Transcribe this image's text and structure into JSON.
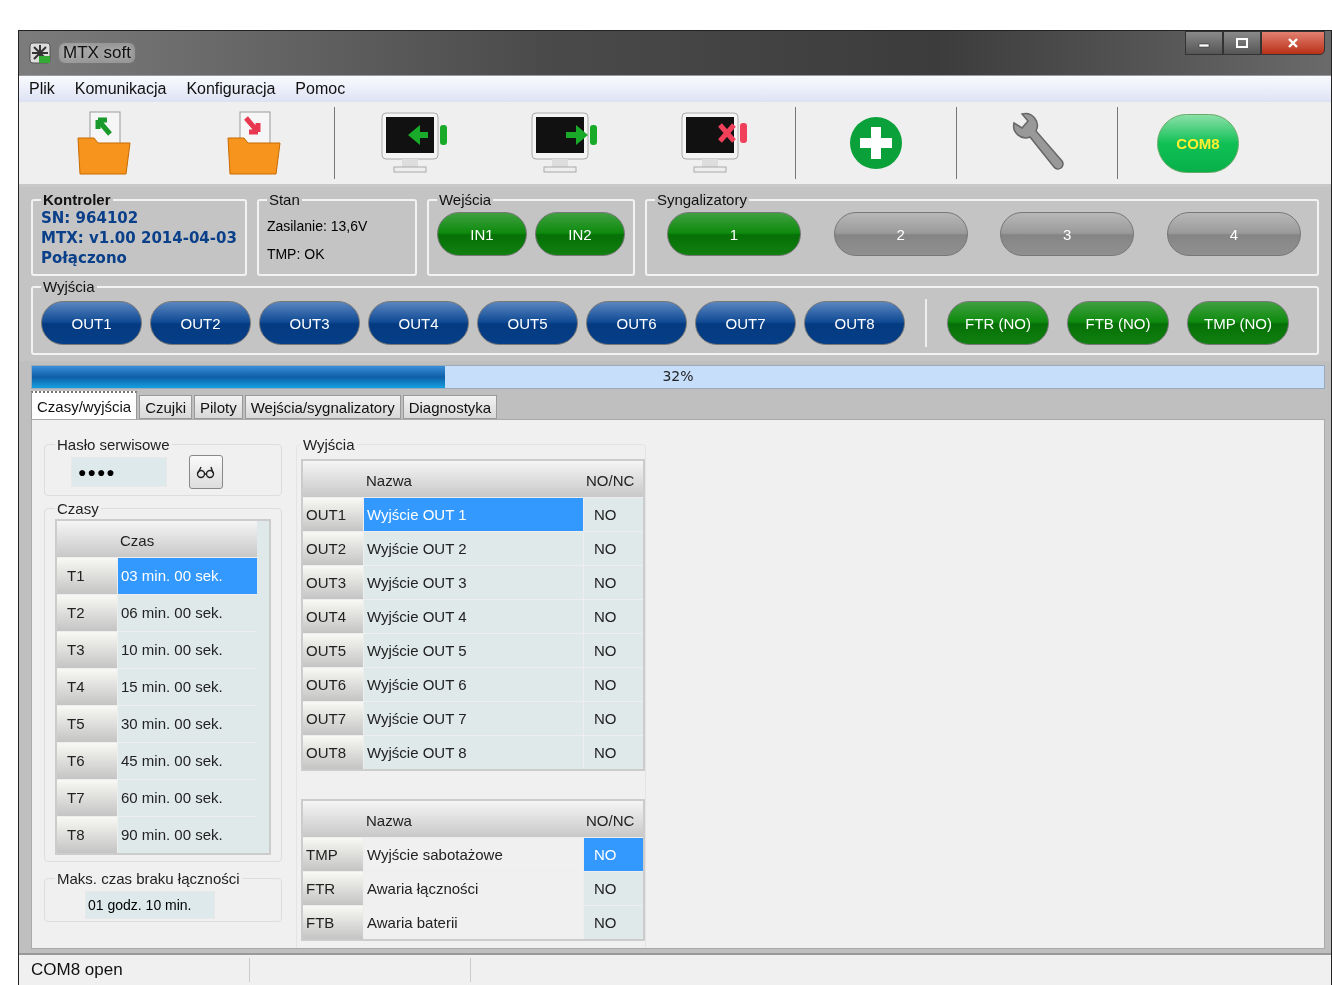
{
  "window": {
    "title": "MTX soft"
  },
  "menu": [
    "Plik",
    "Komunikacja",
    "Konfiguracja",
    "Pomoc"
  ],
  "toolbar": {
    "port_button": "COM8"
  },
  "controller": {
    "title": "Kontroler",
    "lines": [
      "SN:  964102",
      "MTX: v1.00 2014-04-03",
      "Połączono"
    ]
  },
  "status": {
    "title": "Stan",
    "lines": [
      "Zasilanie: 13,6V",
      "TMP: OK"
    ]
  },
  "inputs": {
    "title": "Wejścia",
    "buttons": [
      {
        "label": "IN1",
        "on": true
      },
      {
        "label": "IN2",
        "on": true
      }
    ]
  },
  "signalers": {
    "title": "Syngalizatory",
    "buttons": [
      {
        "label": "1",
        "on": true
      },
      {
        "label": "2",
        "on": false
      },
      {
        "label": "3",
        "on": false
      },
      {
        "label": "4",
        "on": false
      }
    ]
  },
  "outputs": {
    "title": "Wyjścia",
    "buttons": [
      {
        "label": "OUT1",
        "kind": "output"
      },
      {
        "label": "OUT2",
        "kind": "output"
      },
      {
        "label": "OUT3",
        "kind": "output"
      },
      {
        "label": "OUT4",
        "kind": "output"
      },
      {
        "label": "OUT5",
        "kind": "output"
      },
      {
        "label": "OUT6",
        "kind": "output"
      },
      {
        "label": "OUT7",
        "kind": "output"
      },
      {
        "label": "OUT8",
        "kind": "output"
      }
    ],
    "fault_buttons": [
      {
        "label": "FTR (NO)",
        "kind": "fault"
      },
      {
        "label": "FTB (NO)",
        "kind": "fault"
      },
      {
        "label": "TMP (NO)",
        "kind": "fault"
      }
    ]
  },
  "progress": {
    "level": 0.32,
    "reading": "32%"
  },
  "tabs": [
    {
      "label": "Czasy/wyjścia",
      "selected": true
    },
    {
      "label": "Czujki",
      "selected": false
    },
    {
      "label": "Piloty",
      "selected": false
    },
    {
      "label": "Wejścia/sygnalizatory",
      "selected": false
    },
    {
      "label": "Diagnostyka",
      "selected": false
    }
  ],
  "password": {
    "title": "Hasło serwisowe",
    "value": "●●●●"
  },
  "times": {
    "title": "Czasy",
    "column": "Czas",
    "rows": [
      {
        "label": "T1",
        "value": "03 min. 00 sek.",
        "selected": true
      },
      {
        "label": "T2",
        "value": "06 min. 00 sek.",
        "selected": false
      },
      {
        "label": "T3",
        "value": "10 min. 00 sek.",
        "selected": false
      },
      {
        "label": "T4",
        "value": "15 min. 00 sek.",
        "selected": false
      },
      {
        "label": "T5",
        "value": "30 min. 00 sek.",
        "selected": false
      },
      {
        "label": "T6",
        "value": "45 min. 00 sek.",
        "selected": false
      },
      {
        "label": "T7",
        "value": "60 min. 00 sek.",
        "selected": false
      },
      {
        "label": "T8",
        "value": "90 min. 00 sek.",
        "selected": false
      }
    ]
  },
  "max_offline": {
    "title": "Maks. czas braku łączności",
    "value": "01 godz. 10 min."
  },
  "outputs_panel": {
    "title": "Wyjścia",
    "tables": [
      {
        "columns": [
          "Nazwa",
          "NO/NC"
        ],
        "rows": [
          {
            "id": "OUT1",
            "name": "Wyjście OUT 1",
            "mode": "NO",
            "name_selected": true,
            "mode_selected": false
          },
          {
            "id": "OUT2",
            "name": "Wyjście OUT 2",
            "mode": "NO",
            "name_selected": false,
            "mode_selected": false
          },
          {
            "id": "OUT3",
            "name": "Wyjście OUT 3",
            "mode": "NO",
            "name_selected": false,
            "mode_selected": false
          },
          {
            "id": "OUT4",
            "name": "Wyjście OUT 4",
            "mode": "NO",
            "name_selected": false,
            "mode_selected": false
          },
          {
            "id": "OUT5",
            "name": "Wyjście OUT 5",
            "mode": "NO",
            "name_selected": false,
            "mode_selected": false
          },
          {
            "id": "OUT6",
            "name": "Wyjście OUT 6",
            "mode": "NO",
            "name_selected": false,
            "mode_selected": false
          },
          {
            "id": "OUT7",
            "name": "Wyjście OUT 7",
            "mode": "NO",
            "name_selected": false,
            "mode_selected": false
          },
          {
            "id": "OUT8",
            "name": "Wyjście OUT 8",
            "mode": "NO",
            "name_selected": false,
            "mode_selected": false
          }
        ]
      },
      {
        "columns": [
          "Nazwa",
          "NO/NC"
        ],
        "rows": [
          {
            "id": "TMP",
            "name": "Wyjście sabotażowe",
            "mode": "NO",
            "name_selected": false,
            "mode_selected": true
          },
          {
            "id": "FTR",
            "name": "Awaria łączności",
            "mode": "NO",
            "name_selected": false,
            "mode_selected": false
          },
          {
            "id": "FTB",
            "name": "Awaria baterii",
            "mode": "NO",
            "name_selected": false,
            "mode_selected": false
          }
        ]
      }
    ]
  },
  "status_bar": {
    "text": "COM8 open"
  }
}
